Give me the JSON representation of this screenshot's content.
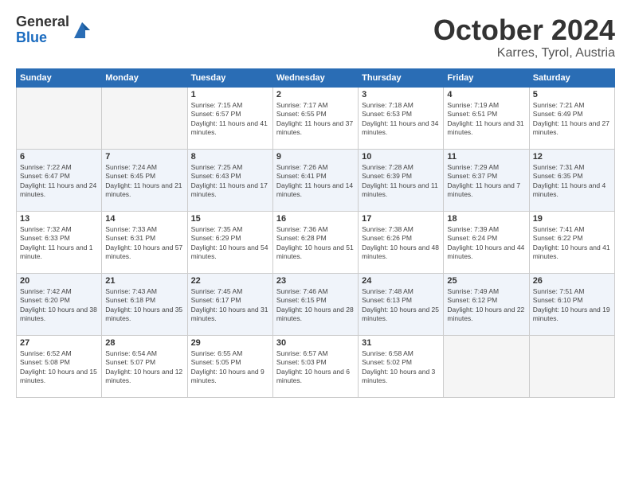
{
  "header": {
    "logo_general": "General",
    "logo_blue": "Blue",
    "month_title": "October 2024",
    "subtitle": "Karres, Tyrol, Austria"
  },
  "weekdays": [
    "Sunday",
    "Monday",
    "Tuesday",
    "Wednesday",
    "Thursday",
    "Friday",
    "Saturday"
  ],
  "weeks": [
    [
      {
        "day": "",
        "info": ""
      },
      {
        "day": "",
        "info": ""
      },
      {
        "day": "1",
        "info": "Sunrise: 7:15 AM\nSunset: 6:57 PM\nDaylight: 11 hours and 41 minutes."
      },
      {
        "day": "2",
        "info": "Sunrise: 7:17 AM\nSunset: 6:55 PM\nDaylight: 11 hours and 37 minutes."
      },
      {
        "day": "3",
        "info": "Sunrise: 7:18 AM\nSunset: 6:53 PM\nDaylight: 11 hours and 34 minutes."
      },
      {
        "day": "4",
        "info": "Sunrise: 7:19 AM\nSunset: 6:51 PM\nDaylight: 11 hours and 31 minutes."
      },
      {
        "day": "5",
        "info": "Sunrise: 7:21 AM\nSunset: 6:49 PM\nDaylight: 11 hours and 27 minutes."
      }
    ],
    [
      {
        "day": "6",
        "info": "Sunrise: 7:22 AM\nSunset: 6:47 PM\nDaylight: 11 hours and 24 minutes."
      },
      {
        "day": "7",
        "info": "Sunrise: 7:24 AM\nSunset: 6:45 PM\nDaylight: 11 hours and 21 minutes."
      },
      {
        "day": "8",
        "info": "Sunrise: 7:25 AM\nSunset: 6:43 PM\nDaylight: 11 hours and 17 minutes."
      },
      {
        "day": "9",
        "info": "Sunrise: 7:26 AM\nSunset: 6:41 PM\nDaylight: 11 hours and 14 minutes."
      },
      {
        "day": "10",
        "info": "Sunrise: 7:28 AM\nSunset: 6:39 PM\nDaylight: 11 hours and 11 minutes."
      },
      {
        "day": "11",
        "info": "Sunrise: 7:29 AM\nSunset: 6:37 PM\nDaylight: 11 hours and 7 minutes."
      },
      {
        "day": "12",
        "info": "Sunrise: 7:31 AM\nSunset: 6:35 PM\nDaylight: 11 hours and 4 minutes."
      }
    ],
    [
      {
        "day": "13",
        "info": "Sunrise: 7:32 AM\nSunset: 6:33 PM\nDaylight: 11 hours and 1 minute."
      },
      {
        "day": "14",
        "info": "Sunrise: 7:33 AM\nSunset: 6:31 PM\nDaylight: 10 hours and 57 minutes."
      },
      {
        "day": "15",
        "info": "Sunrise: 7:35 AM\nSunset: 6:29 PM\nDaylight: 10 hours and 54 minutes."
      },
      {
        "day": "16",
        "info": "Sunrise: 7:36 AM\nSunset: 6:28 PM\nDaylight: 10 hours and 51 minutes."
      },
      {
        "day": "17",
        "info": "Sunrise: 7:38 AM\nSunset: 6:26 PM\nDaylight: 10 hours and 48 minutes."
      },
      {
        "day": "18",
        "info": "Sunrise: 7:39 AM\nSunset: 6:24 PM\nDaylight: 10 hours and 44 minutes."
      },
      {
        "day": "19",
        "info": "Sunrise: 7:41 AM\nSunset: 6:22 PM\nDaylight: 10 hours and 41 minutes."
      }
    ],
    [
      {
        "day": "20",
        "info": "Sunrise: 7:42 AM\nSunset: 6:20 PM\nDaylight: 10 hours and 38 minutes."
      },
      {
        "day": "21",
        "info": "Sunrise: 7:43 AM\nSunset: 6:18 PM\nDaylight: 10 hours and 35 minutes."
      },
      {
        "day": "22",
        "info": "Sunrise: 7:45 AM\nSunset: 6:17 PM\nDaylight: 10 hours and 31 minutes."
      },
      {
        "day": "23",
        "info": "Sunrise: 7:46 AM\nSunset: 6:15 PM\nDaylight: 10 hours and 28 minutes."
      },
      {
        "day": "24",
        "info": "Sunrise: 7:48 AM\nSunset: 6:13 PM\nDaylight: 10 hours and 25 minutes."
      },
      {
        "day": "25",
        "info": "Sunrise: 7:49 AM\nSunset: 6:12 PM\nDaylight: 10 hours and 22 minutes."
      },
      {
        "day": "26",
        "info": "Sunrise: 7:51 AM\nSunset: 6:10 PM\nDaylight: 10 hours and 19 minutes."
      }
    ],
    [
      {
        "day": "27",
        "info": "Sunrise: 6:52 AM\nSunset: 5:08 PM\nDaylight: 10 hours and 15 minutes."
      },
      {
        "day": "28",
        "info": "Sunrise: 6:54 AM\nSunset: 5:07 PM\nDaylight: 10 hours and 12 minutes."
      },
      {
        "day": "29",
        "info": "Sunrise: 6:55 AM\nSunset: 5:05 PM\nDaylight: 10 hours and 9 minutes."
      },
      {
        "day": "30",
        "info": "Sunrise: 6:57 AM\nSunset: 5:03 PM\nDaylight: 10 hours and 6 minutes."
      },
      {
        "day": "31",
        "info": "Sunrise: 6:58 AM\nSunset: 5:02 PM\nDaylight: 10 hours and 3 minutes."
      },
      {
        "day": "",
        "info": ""
      },
      {
        "day": "",
        "info": ""
      }
    ]
  ]
}
